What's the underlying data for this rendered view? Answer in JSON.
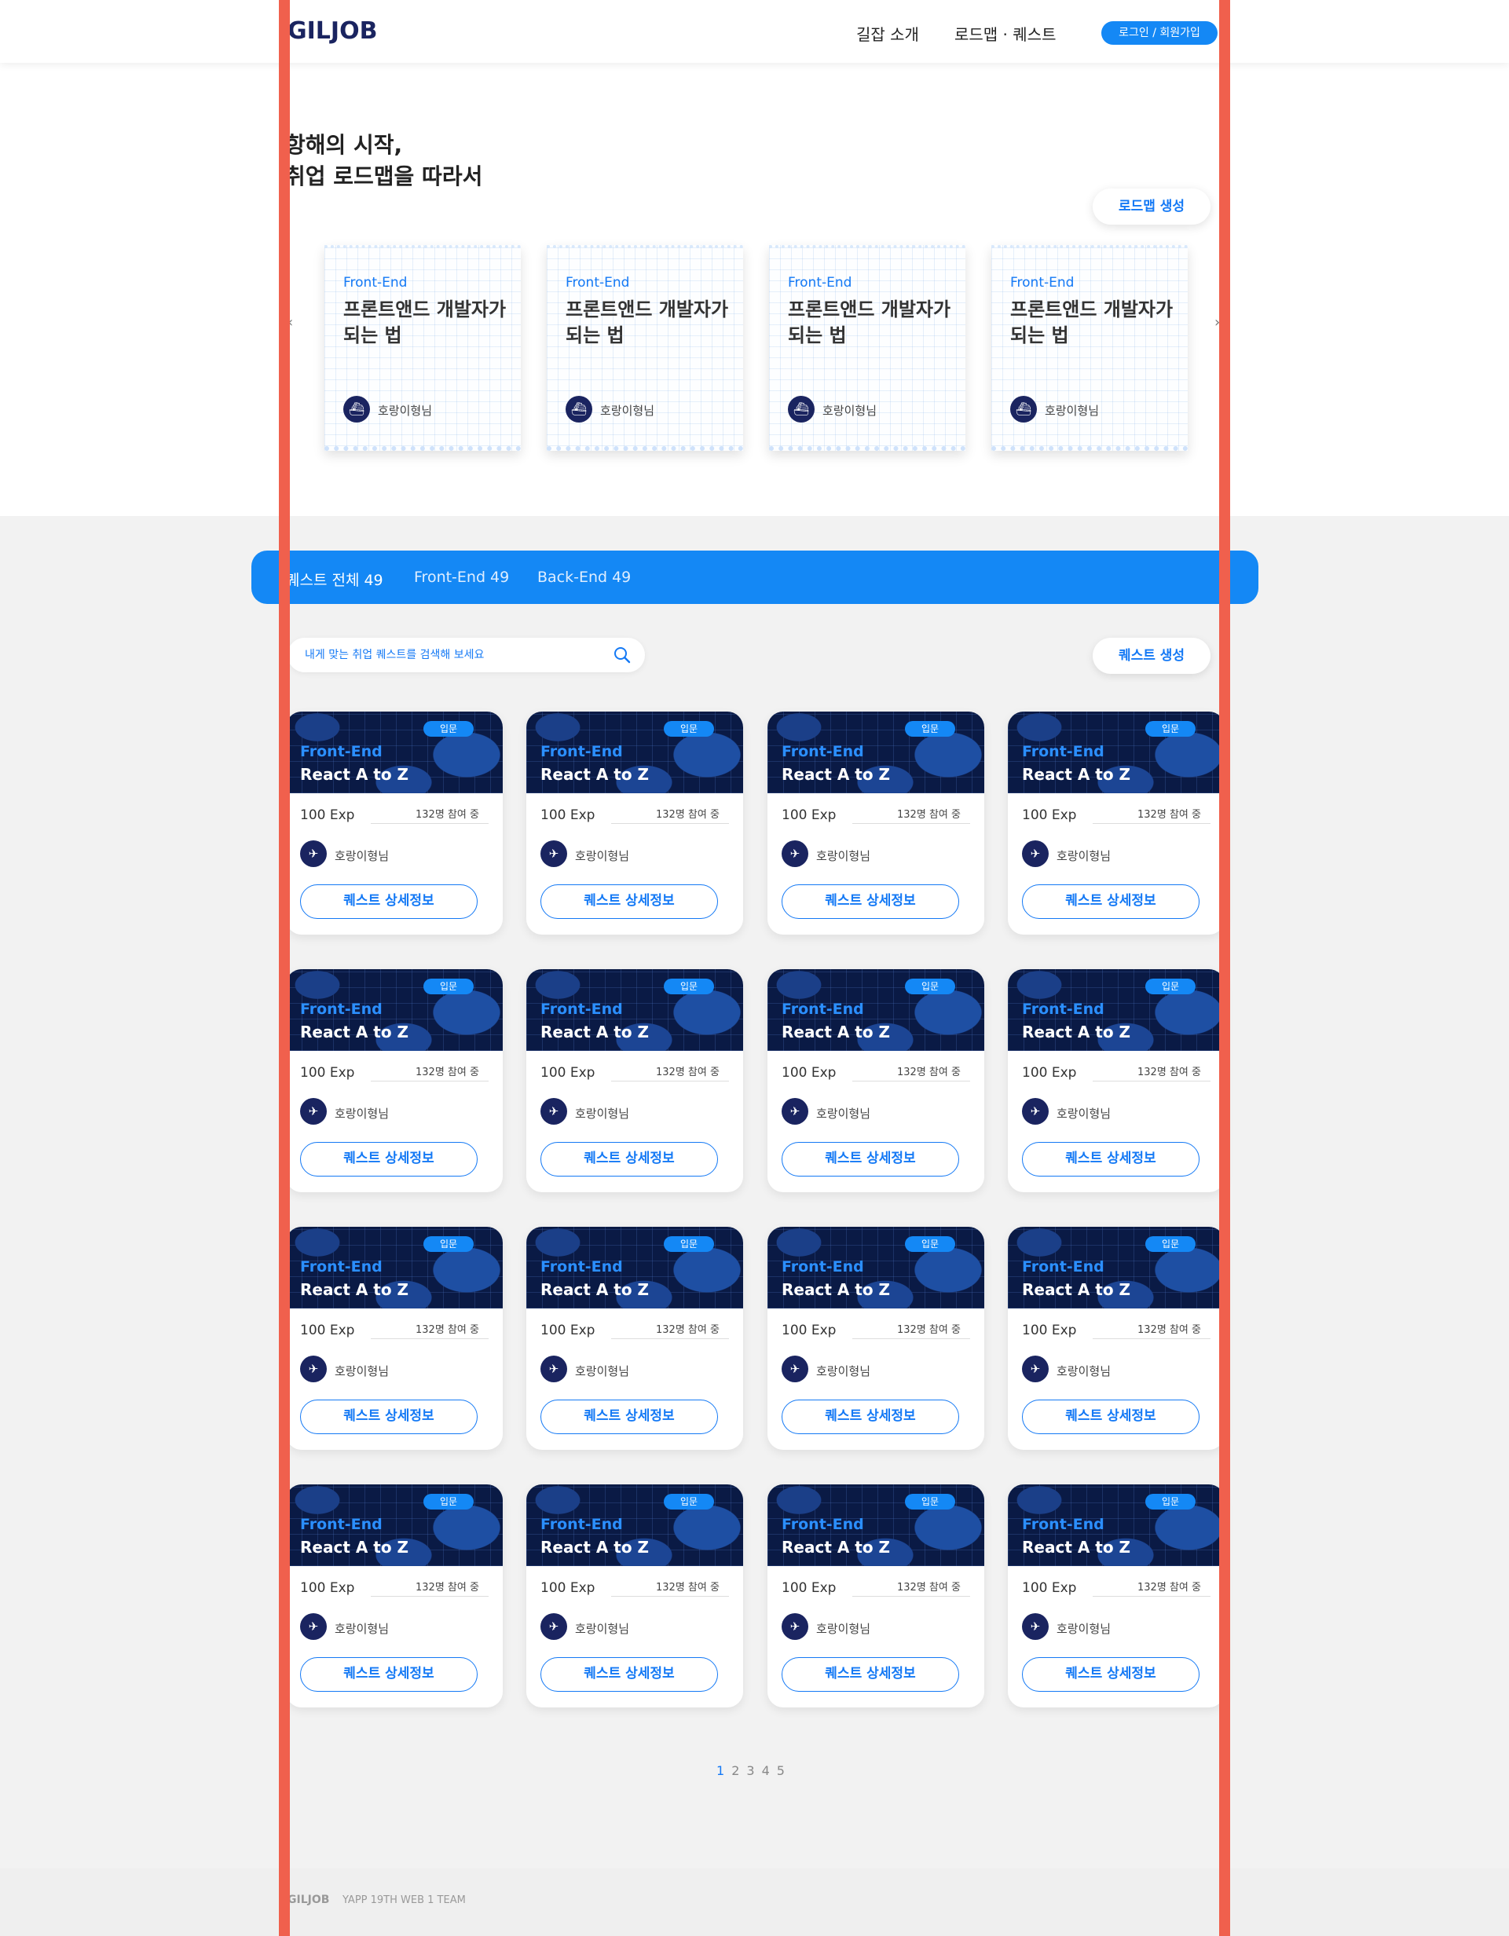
{
  "header": {
    "logo": "GILJOB",
    "nav": [
      {
        "label": "길잡 소개"
      },
      {
        "label": "로드맵 · 퀘스트"
      }
    ],
    "login_label": "로그인 / 회원가입"
  },
  "hero": {
    "title_line1": "항해의 시작,",
    "title_line2": "취업 로드맵을 따라서",
    "create_roadmap_label": "로드맵 생성",
    "arrow_left": "‹",
    "arrow_right": "›"
  },
  "roadmaps": [
    {
      "category": "Front-End",
      "title": "프론트앤드 개발자가 되는 법",
      "author": "호랑이형님"
    },
    {
      "category": "Front-End",
      "title": "프론트앤드 개발자가 되는 법",
      "author": "호랑이형님"
    },
    {
      "category": "Front-End",
      "title": "프론트앤드 개발자가 되는 법",
      "author": "호랑이형님"
    },
    {
      "category": "Front-End",
      "title": "프론트앤드 개발자가 되는 법",
      "author": "호랑이형님"
    }
  ],
  "tabs": [
    {
      "label": "퀘스트 전체",
      "count": "49"
    },
    {
      "label": "Front-End",
      "count": "49"
    },
    {
      "label": "Back-End",
      "count": "49"
    }
  ],
  "search": {
    "placeholder": "내게 맞는 취업 퀘스트를 검색해 보세요"
  },
  "create_quest_label": "퀘스트 생성",
  "quest_card": {
    "badge": "입문",
    "category": "Front-End",
    "title": "React A to Z",
    "exp": "100 Exp",
    "participants": "132명 참여 중",
    "author": "호랑이형님",
    "button_label": "퀘스트 상세정보"
  },
  "quest_rows": 4,
  "quest_cols": 4,
  "pagination": [
    "1",
    "2",
    "3",
    "4",
    "5"
  ],
  "footer": {
    "logo": "GILJOB",
    "team": "YAPP 19TH WEB 1 TEAM"
  },
  "colors": {
    "accent": "#1488f5",
    "navy": "#1a2460",
    "guide": "#f0604d"
  }
}
